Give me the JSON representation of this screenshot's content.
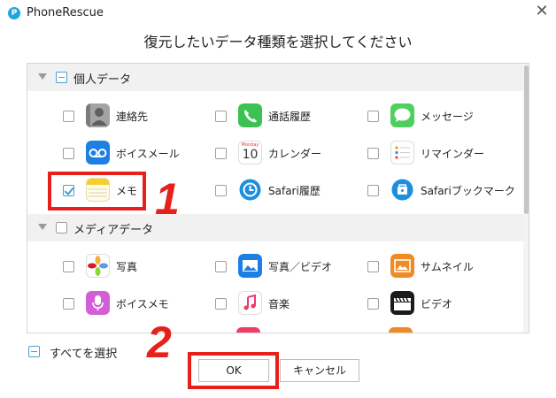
{
  "app": {
    "name": "PhoneRescue",
    "logo_letter": "P"
  },
  "window": {
    "close_glyph": "✕"
  },
  "dialog": {
    "title": "復元したいデータ種類を選択してください"
  },
  "sections": [
    {
      "label": "個人データ",
      "state": "partial",
      "items": [
        {
          "label": "連絡先",
          "icon": "contacts-icon",
          "checked": false
        },
        {
          "label": "通話履歴",
          "icon": "phone-icon",
          "checked": false
        },
        {
          "label": "メッセージ",
          "icon": "messages-icon",
          "checked": false
        },
        {
          "label": "ボイスメール",
          "icon": "voicemail-icon",
          "checked": false
        },
        {
          "label": "カレンダー",
          "icon": "calendar-icon",
          "checked": false,
          "calendar_month": "Monday",
          "calendar_day": "10"
        },
        {
          "label": "リマインダー",
          "icon": "reminders-icon",
          "checked": false
        },
        {
          "label": "メモ",
          "icon": "notes-icon",
          "checked": true
        },
        {
          "label": "Safari履歴",
          "icon": "safari-history-icon",
          "checked": false
        },
        {
          "label": "Safariブックマーク",
          "icon": "safari-bookmark-icon",
          "checked": false
        }
      ]
    },
    {
      "label": "メディアデータ",
      "state": "unchecked",
      "items": [
        {
          "label": "写真",
          "icon": "photos-icon",
          "checked": false
        },
        {
          "label": "写真／ビデオ",
          "icon": "photo-video-icon",
          "checked": false
        },
        {
          "label": "サムネイル",
          "icon": "thumbnail-icon",
          "checked": false
        },
        {
          "label": "ボイスメモ",
          "icon": "voice-memo-icon",
          "checked": false
        },
        {
          "label": "音楽",
          "icon": "music-icon",
          "checked": false
        },
        {
          "label": "ビデオ",
          "icon": "video-icon",
          "checked": false
        }
      ]
    }
  ],
  "footer": {
    "select_all": "すべてを選択",
    "ok": "OK",
    "cancel": "キャンセル"
  },
  "annotations": {
    "step1": "1",
    "step2": "2",
    "color": "#e8201b"
  },
  "colors": {
    "accent": "#47a1cf",
    "section_bg": "#f1f1f1"
  }
}
